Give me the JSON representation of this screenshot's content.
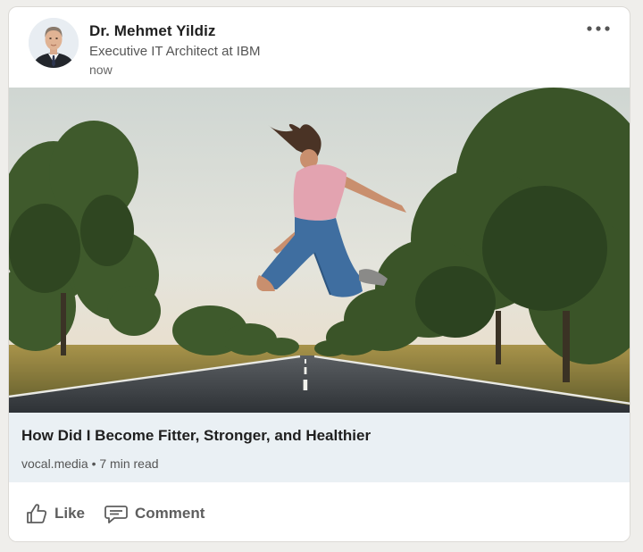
{
  "post": {
    "author": {
      "name": "Dr. Mehmet Yildiz",
      "headline": "Executive IT Architect at IBM",
      "time": "now"
    },
    "more_icon": "ellipsis-horizontal-icon",
    "image": {
      "description_icon": "photo-jumping-woman-on-road"
    },
    "link_preview": {
      "title": "How Did I Become Fitter, Stronger, and Healthier",
      "meta": "vocal.media • 7 min read"
    },
    "actions": {
      "like_label": "Like",
      "comment_label": "Comment"
    }
  },
  "colors": {
    "card_background": "#ffffff",
    "link_preview_background": "#eaf0f4",
    "action_text": "#5e5e5e"
  }
}
